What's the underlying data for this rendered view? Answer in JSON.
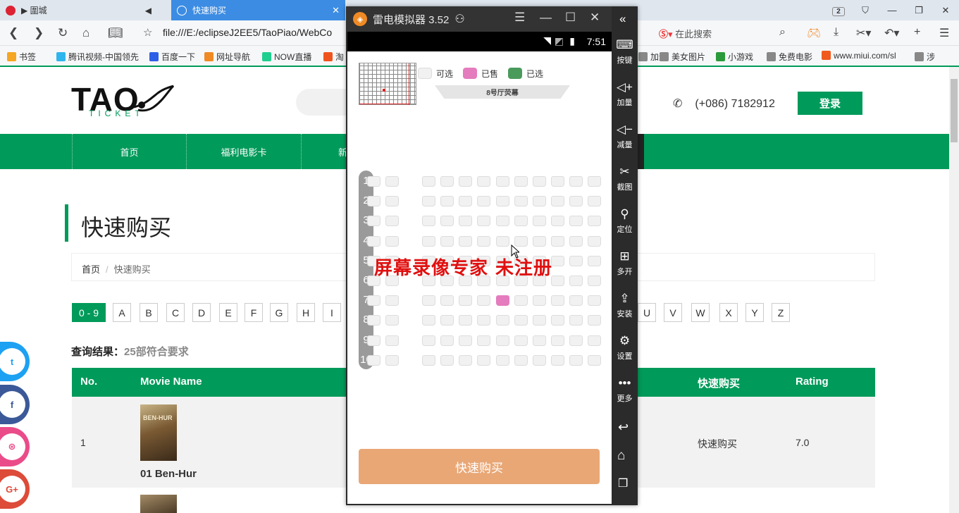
{
  "browser": {
    "tabs": [
      {
        "label": "▶ 圍城"
      },
      {
        "label": "快速购买"
      }
    ],
    "tab_count": "2",
    "address": "file:///E:/eclipseJ2EE5/TaoPiao/WebCo",
    "search_placeholder": "在此搜索",
    "bookmarks": [
      {
        "label": "书签",
        "color": "#f5a623"
      },
      {
        "label": "腾讯视频-中国领先",
        "color": "#2fb5ee"
      },
      {
        "label": "百度一下",
        "color": "#2f5ee6"
      },
      {
        "label": "网址导航",
        "color": "#f08a24"
      },
      {
        "label": "NOW直播",
        "color": "#1fcf8f"
      },
      {
        "label": "淘",
        "color": "#f0541e"
      },
      {
        "label": "加速",
        "color": "#888888"
      },
      {
        "label": "美女图片",
        "color": "#888888"
      },
      {
        "label": "小游戏",
        "color": "#2a9a3a"
      },
      {
        "label": "免费电影",
        "color": "#888888"
      },
      {
        "label": "www.miui.com/sl",
        "color": "#f05a1e"
      },
      {
        "label": "涉",
        "color": "#888888"
      }
    ]
  },
  "site": {
    "logo": "TAO",
    "logo_sub": "TICKET",
    "phone": "(+086) 7182912",
    "login": "登录",
    "nav": [
      "首页",
      "福利电影卡",
      "新"
    ],
    "page_title": "快速购买",
    "breadcrumb": {
      "home": "首页",
      "current": "快速购买"
    },
    "letters_left": [
      "0 - 9",
      "A",
      "B",
      "C",
      "D",
      "E",
      "F",
      "G",
      "H",
      "I"
    ],
    "letters_right": [
      "U",
      "V",
      "W",
      "X",
      "Y",
      "Z"
    ],
    "result_label": "查询结果：",
    "result_count": "25部符合要求",
    "table_headers": {
      "no": "No.",
      "name": "Movie Name",
      "buy": "快速购买",
      "rating": "Rating"
    },
    "rows": [
      {
        "no": "1",
        "name": "01 Ben-Hur",
        "poster_text": "BEN-HUR",
        "buy": "快速购买",
        "rating": "7.0"
      }
    ],
    "social": [
      "twitter",
      "facebook",
      "dribbble",
      "google-plus"
    ]
  },
  "emulator": {
    "title": "雷电模拟器 3.52",
    "time": "7:51",
    "legend": [
      {
        "label": "可选",
        "color": "#f1f1f1"
      },
      {
        "label": "已售",
        "color": "#e47cbd"
      },
      {
        "label": "已选",
        "color": "#4a9a5c"
      }
    ],
    "hall": "8号厅荧幕",
    "rows": [
      "1",
      "2",
      "3",
      "4",
      "5",
      "6",
      "7",
      "8",
      "9",
      "10"
    ],
    "sold_seats": [
      {
        "row": 7,
        "col": 6
      }
    ],
    "buy_label": "快速购买",
    "watermark": "屏幕录像专家  未注册",
    "sidebar": [
      {
        "icon": "keyboard-icon",
        "glyph": "⌨",
        "label": "按键"
      },
      {
        "icon": "volume-up-icon",
        "glyph": "◁+",
        "label": "加量"
      },
      {
        "icon": "volume-down-icon",
        "glyph": "◁−",
        "label": "减量"
      },
      {
        "icon": "scissors-icon",
        "glyph": "✂",
        "label": "截图"
      },
      {
        "icon": "location-icon",
        "glyph": "⚲",
        "label": "定位"
      },
      {
        "icon": "multi-open-icon",
        "glyph": "⊞",
        "label": "多开"
      },
      {
        "icon": "apk-install-icon",
        "glyph": "⇪",
        "label": "安装"
      },
      {
        "icon": "settings-icon",
        "glyph": "⚙",
        "label": "设置"
      },
      {
        "icon": "more-icon",
        "glyph": "•••",
        "label": "更多"
      }
    ]
  }
}
